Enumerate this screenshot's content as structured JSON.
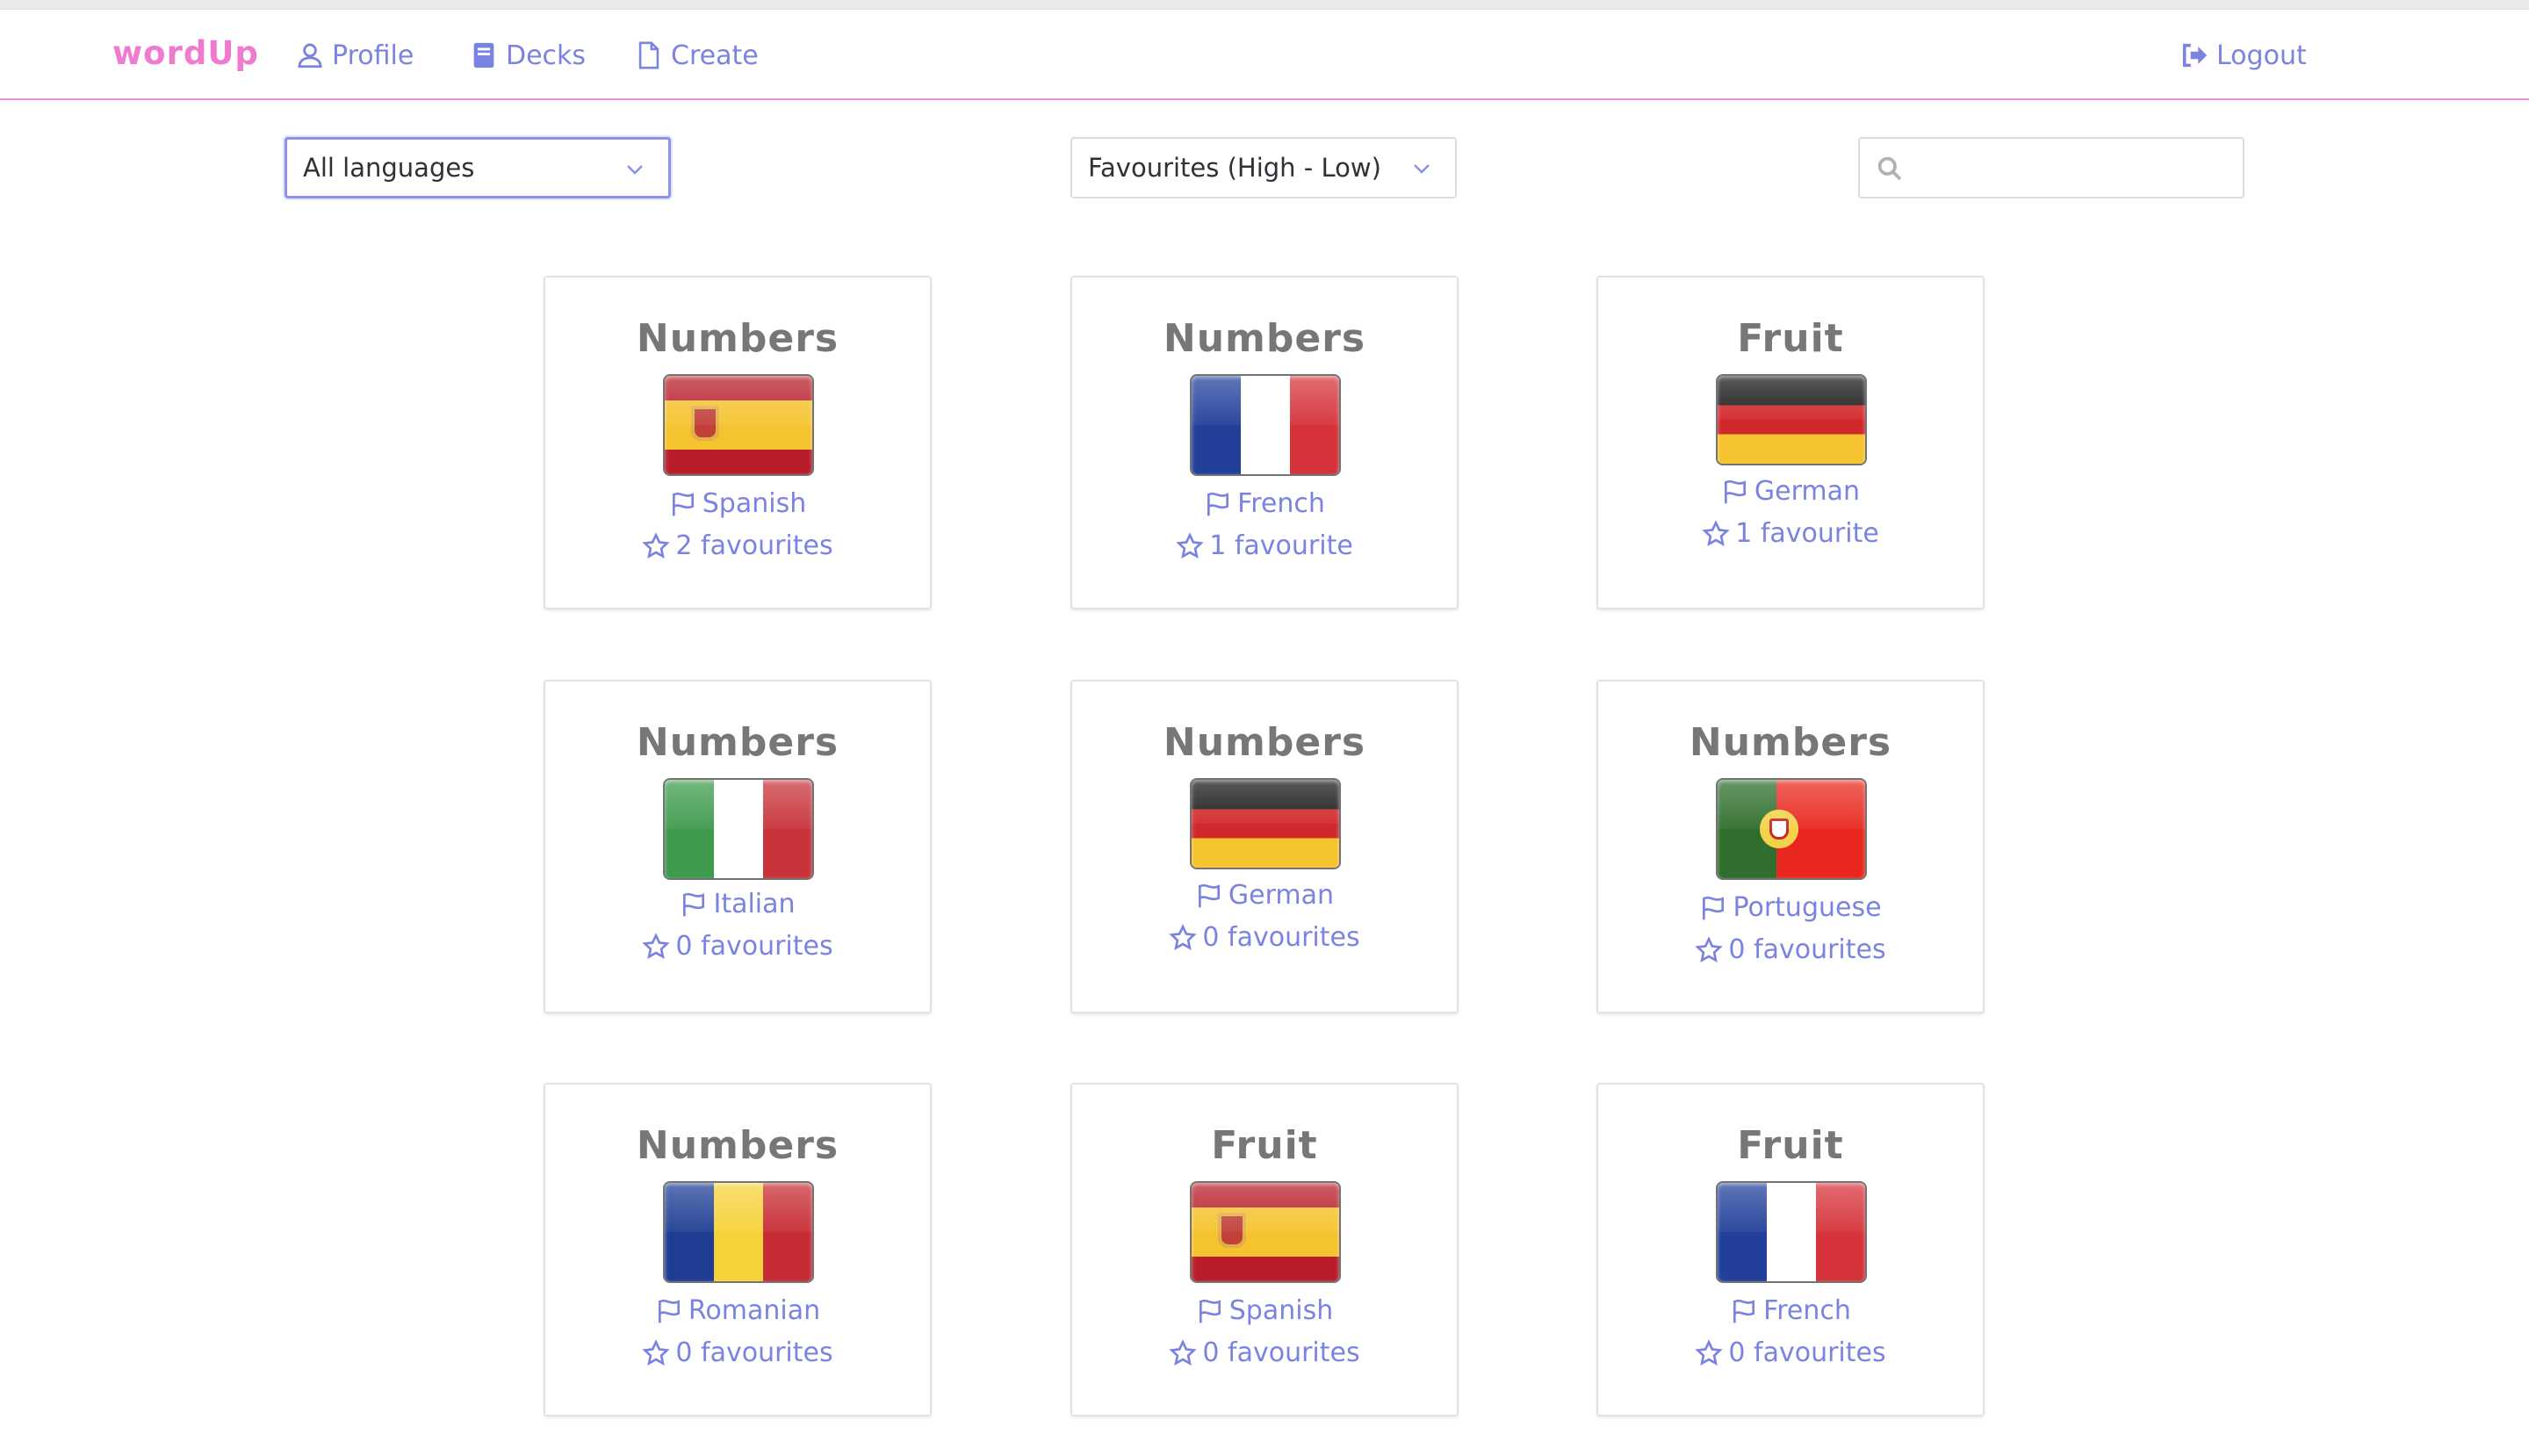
{
  "nav": {
    "brand": "wordUp",
    "profile": "Profile",
    "decks": "Decks",
    "create": "Create",
    "logout": "Logout"
  },
  "filters": {
    "language_selected": "All languages",
    "sort_selected": "Favourites (High - Low)",
    "search_value": "",
    "search_placeholder": ""
  },
  "colors": {
    "brand": "#ee7bd0",
    "link": "#7a84e0",
    "nav_border": "#e88fd6",
    "title": "#77777a"
  },
  "decks": [
    {
      "title": "Numbers",
      "language": "Spanish",
      "favourites": "2 favourites",
      "flag": "spain-flag"
    },
    {
      "title": "Numbers",
      "language": "French",
      "favourites": "1 favourite",
      "flag": "france-flag"
    },
    {
      "title": "Fruit",
      "language": "German",
      "favourites": "1 favourite",
      "flag": "germany-flag"
    },
    {
      "title": "Numbers",
      "language": "Italian",
      "favourites": "0 favourites",
      "flag": "italy-flag"
    },
    {
      "title": "Numbers",
      "language": "German",
      "favourites": "0 favourites",
      "flag": "germany-flag"
    },
    {
      "title": "Numbers",
      "language": "Portuguese",
      "favourites": "0 favourites",
      "flag": "portugal-flag"
    },
    {
      "title": "Numbers",
      "language": "Romanian",
      "favourites": "0 favourites",
      "flag": "romania-flag"
    },
    {
      "title": "Fruit",
      "language": "Spanish",
      "favourites": "0 favourites",
      "flag": "spain-flag"
    },
    {
      "title": "Fruit",
      "language": "French",
      "favourites": "0 favourites",
      "flag": "france-flag"
    }
  ]
}
